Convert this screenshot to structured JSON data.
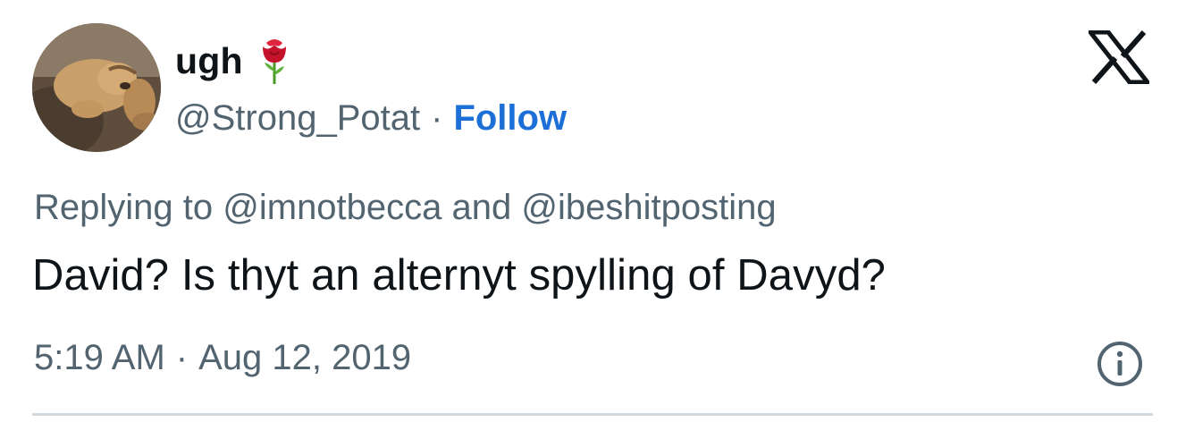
{
  "author": {
    "display_name": "ugh",
    "handle": "@Strong_Potat",
    "separator": "·",
    "follow_label": "Follow",
    "emoji_icon": "rose-icon"
  },
  "reply": {
    "prefix": "Replying to",
    "mention_1": "@imnotbecca",
    "connector": "and",
    "mention_2": "@ibeshitposting"
  },
  "tweet": {
    "text": "David? Is thyt an alternyt spylling of Davyd?",
    "time": "5:19 AM",
    "separator": "·",
    "date": "Aug 12, 2019"
  },
  "icons": {
    "logo": "x-logo-icon",
    "info": "info-icon"
  },
  "colors": {
    "text_primary": "#0f1419",
    "text_secondary": "#536471",
    "follow_blue": "#1d6fd8",
    "divider": "#cfd9de"
  }
}
